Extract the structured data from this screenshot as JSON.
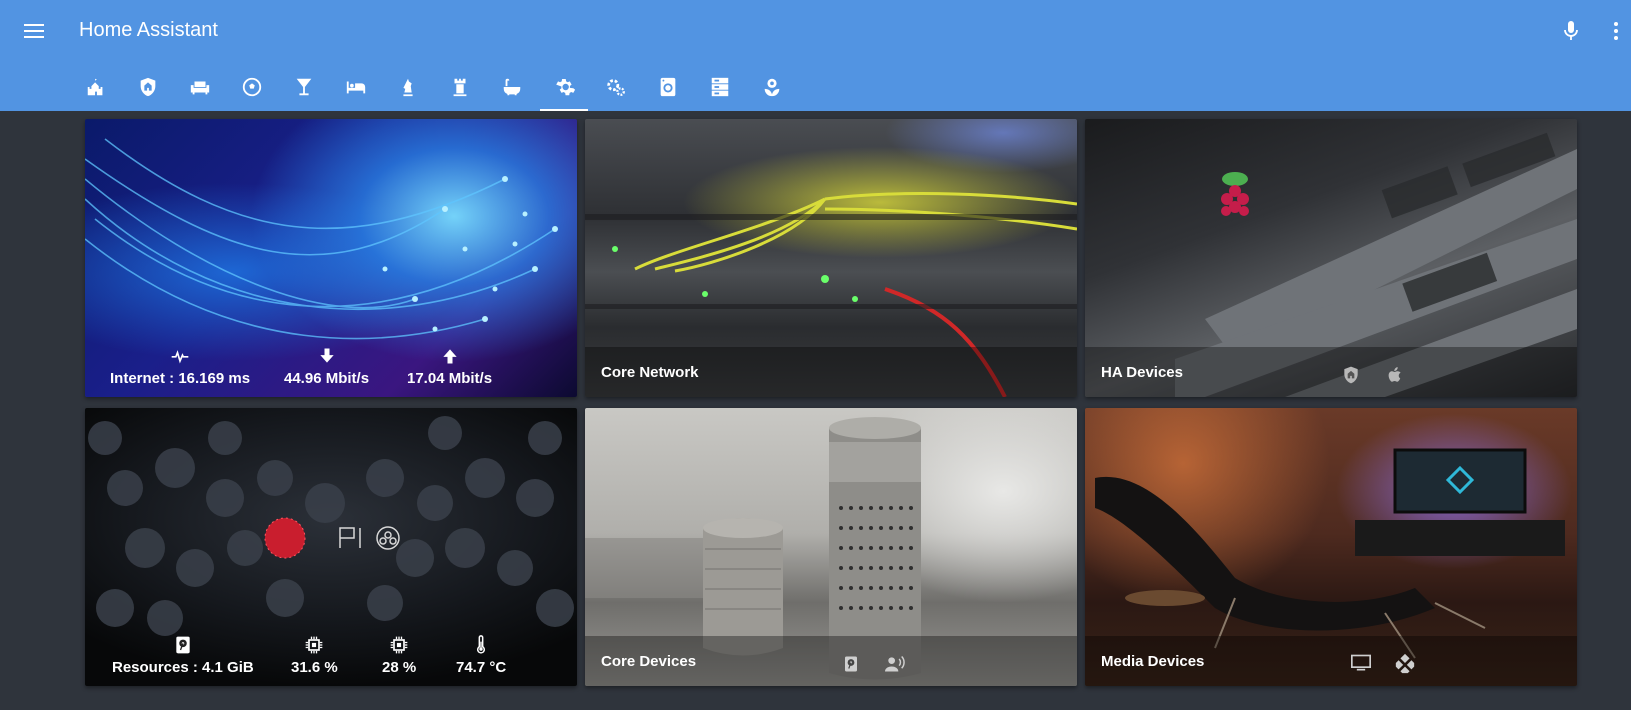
{
  "header": {
    "title": "Home Assistant",
    "menu_icon": "menu-icon",
    "mic_icon": "microphone-icon",
    "more_icon": "dots-vertical-icon",
    "background": "#5294e2"
  },
  "tabs": [
    {
      "icon": "castle-home-icon",
      "active": false
    },
    {
      "icon": "shield-home-icon",
      "active": false
    },
    {
      "icon": "sofa-icon",
      "active": false
    },
    {
      "icon": "soccer-ball-icon",
      "active": false
    },
    {
      "icon": "martini-glass-icon",
      "active": false
    },
    {
      "icon": "bed-icon",
      "active": false
    },
    {
      "icon": "chess-knight-icon",
      "active": false
    },
    {
      "icon": "chess-rook-icon",
      "active": false
    },
    {
      "icon": "bathtub-icon",
      "active": false
    },
    {
      "icon": "gear-icon",
      "active": true
    },
    {
      "icon": "settings-gears-icon",
      "active": false
    },
    {
      "icon": "washing-machine-icon",
      "active": false
    },
    {
      "icon": "server-icon",
      "active": false
    },
    {
      "icon": "flower-plant-icon",
      "active": false
    }
  ],
  "cards": {
    "internet": {
      "stats": [
        {
          "icon": "pulse-icon",
          "label": "Internet : 16.169 ms"
        },
        {
          "icon": "download-arrow-icon",
          "label": "44.96 Mbit/s"
        },
        {
          "icon": "upload-arrow-icon",
          "label": "17.04 Mbit/s"
        }
      ]
    },
    "core_network": {
      "title": "Core Network"
    },
    "ha_devices": {
      "title": "HA Devices",
      "icons": [
        "home-assistant-icon",
        "apple-icon"
      ]
    },
    "resources": {
      "stats": [
        {
          "icon": "harddisk-icon",
          "label": "Resources : 4.1 GiB"
        },
        {
          "icon": "cpu-chip-icon",
          "label": "31.6 %"
        },
        {
          "icon": "memory-chip-icon",
          "label": "28 %"
        },
        {
          "icon": "thermometer-icon",
          "label": "74.7 °C"
        }
      ]
    },
    "core_devices": {
      "title": "Core Devices",
      "icons": [
        "harddisk-icon",
        "speaker-voice-icon"
      ]
    },
    "media_devices": {
      "title": "Media Devices",
      "icons": [
        "television-icon",
        "kodi-icon"
      ]
    }
  }
}
